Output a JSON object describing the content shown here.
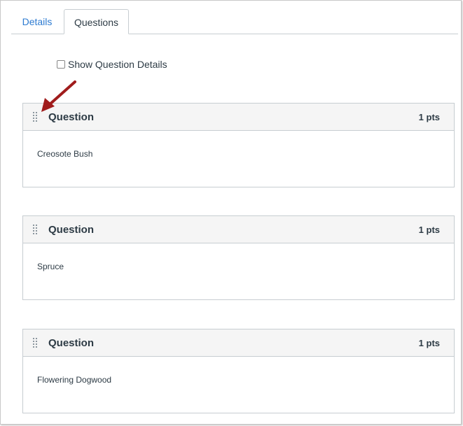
{
  "tabs": [
    {
      "label": "Details"
    },
    {
      "label": "Questions"
    }
  ],
  "show_details_label": "Show Question Details",
  "questions": [
    {
      "title": "Question",
      "points": "1 pts",
      "text": "Creosote Bush"
    },
    {
      "title": "Question",
      "points": "1 pts",
      "text": "Spruce"
    },
    {
      "title": "Question",
      "points": "1 pts",
      "text": "Flowering Dogwood"
    }
  ],
  "colors": {
    "annotation_arrow": "#a01c1c",
    "link": "#2d7bd1"
  }
}
